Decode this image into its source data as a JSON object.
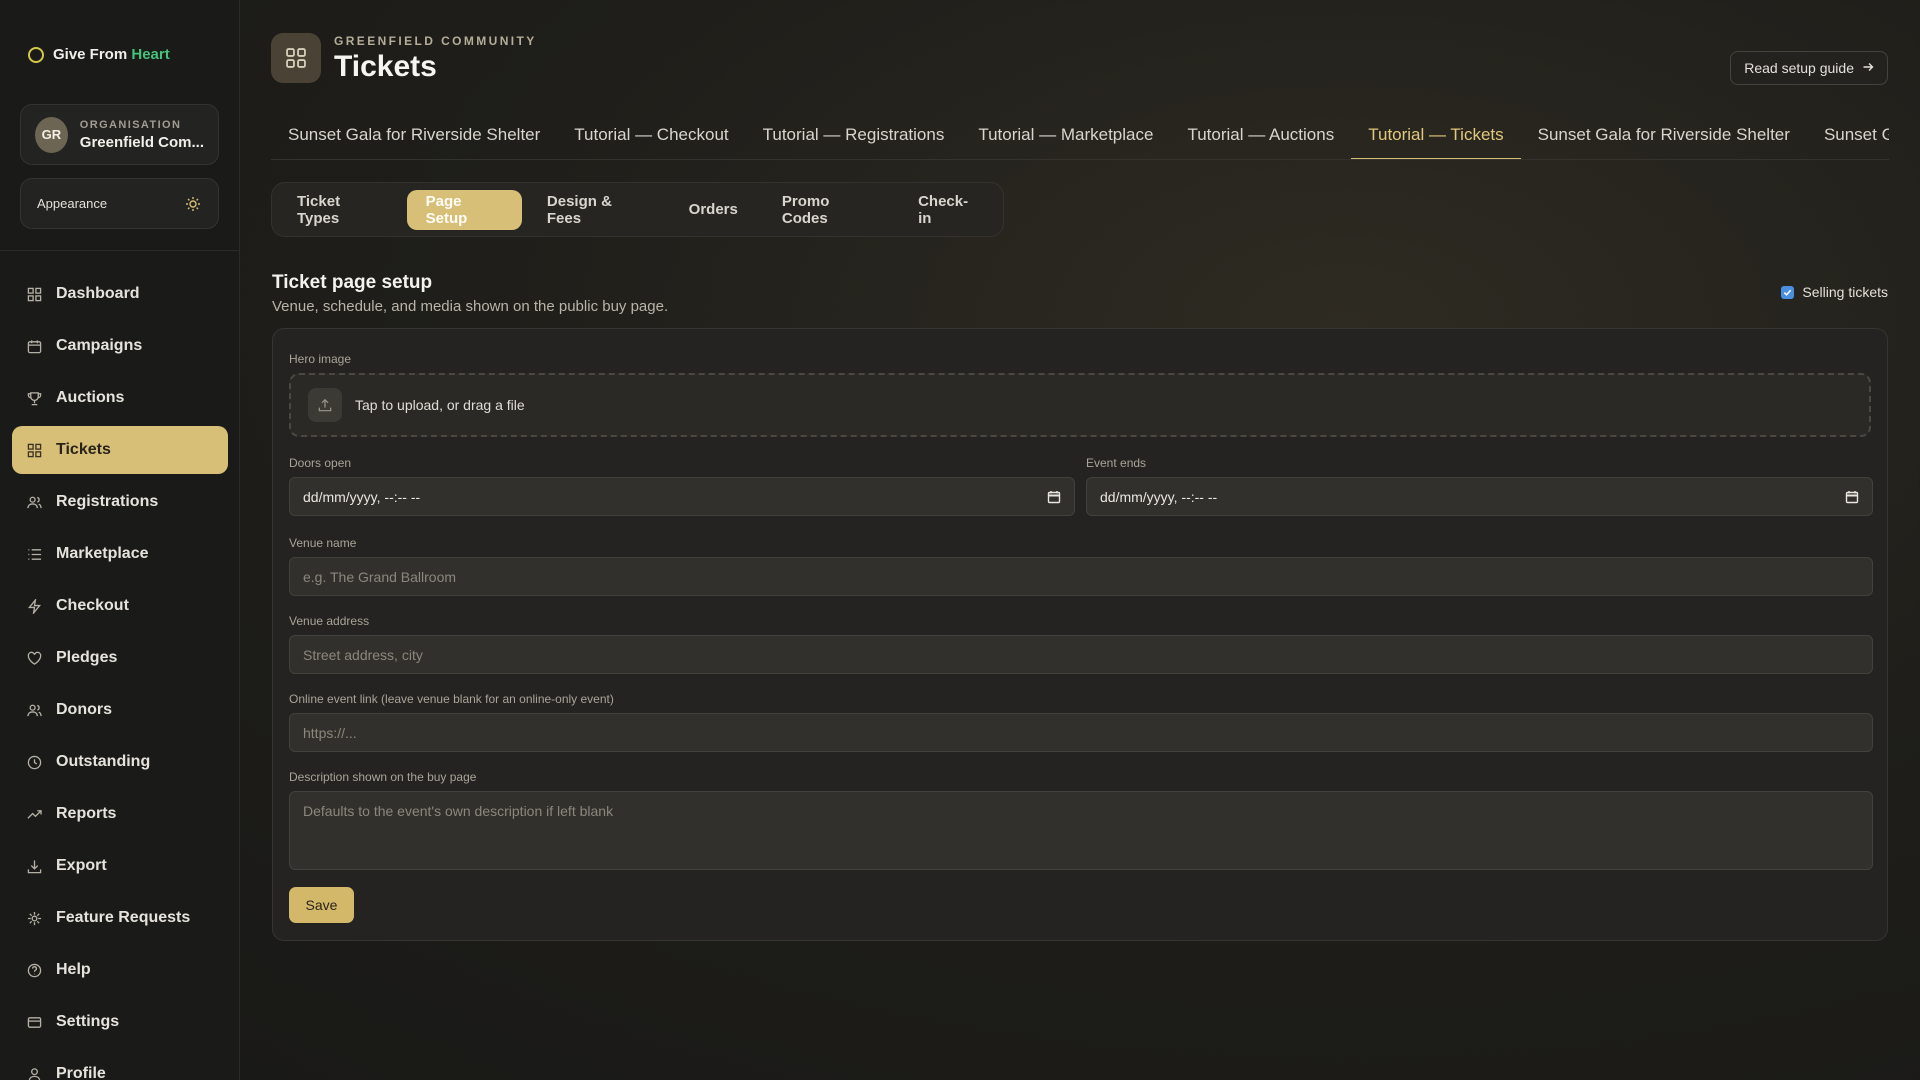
{
  "brand": {
    "name_prefix": "Give From ",
    "name_accent": "Heart"
  },
  "org": {
    "initials": "GR",
    "label": "ORGANISATION",
    "name": "Greenfield Com..."
  },
  "appearance": {
    "label": "Appearance",
    "icon": "sun-icon"
  },
  "sidebar": {
    "items": [
      {
        "label": "Dashboard",
        "icon": "dashboard-icon"
      },
      {
        "label": "Campaigns",
        "icon": "calendar-icon"
      },
      {
        "label": "Auctions",
        "icon": "trophy-icon"
      },
      {
        "label": "Tickets",
        "icon": "tickets-icon",
        "active": true
      },
      {
        "label": "Registrations",
        "icon": "users-icon"
      },
      {
        "label": "Marketplace",
        "icon": "list-icon"
      },
      {
        "label": "Checkout",
        "icon": "bolt-icon"
      },
      {
        "label": "Pledges",
        "icon": "heart-icon"
      },
      {
        "label": "Donors",
        "icon": "donors-icon"
      },
      {
        "label": "Outstanding",
        "icon": "clock-icon"
      },
      {
        "label": "Reports",
        "icon": "trend-icon"
      },
      {
        "label": "Export",
        "icon": "download-icon"
      },
      {
        "label": "Feature Requests",
        "icon": "spark-icon"
      },
      {
        "label": "Help",
        "icon": "help-icon"
      },
      {
        "label": "Settings",
        "icon": "card-icon"
      },
      {
        "label": "Profile",
        "icon": "profile-icon"
      }
    ]
  },
  "header": {
    "eyebrow": "GREENFIELD COMMUNITY",
    "title": "Tickets",
    "guide_button": "Read setup guide"
  },
  "event_tabs": [
    "Sunset Gala for Riverside Shelter",
    "Tutorial — Checkout",
    "Tutorial — Registrations",
    "Tutorial — Marketplace",
    "Tutorial — Auctions",
    "Tutorial — Tickets",
    "Sunset Gala for Riverside Shelter",
    "Sunset G"
  ],
  "active_event_tab": 5,
  "sub_tabs": [
    "Ticket Types",
    "Page Setup",
    "Design & Fees",
    "Orders",
    "Promo Codes",
    "Check-in"
  ],
  "active_sub_tab": 1,
  "section": {
    "title": "Ticket page setup",
    "subtitle": "Venue, schedule, and media shown on the public buy page.",
    "selling_label": "Selling tickets",
    "selling_checked": true
  },
  "form": {
    "hero_label": "Hero image",
    "upload_text": "Tap to upload, or drag a file",
    "doors_label": "Doors open",
    "doors_value": "dd/mm/yyyy, --:-- --",
    "ends_label": "Event ends",
    "ends_value": "dd/mm/yyyy, --:-- --",
    "venue_name_label": "Venue name",
    "venue_name_placeholder": "e.g. The Grand Ballroom",
    "venue_address_label": "Venue address",
    "venue_address_placeholder": "Street address, city",
    "online_label": "Online event link (leave venue blank for an online-only event)",
    "online_placeholder": "https://...",
    "description_label": "Description shown on the buy page",
    "description_placeholder": "Defaults to the event's own description if left blank",
    "save_label": "Save"
  },
  "colors": {
    "accent": "#d8bf78",
    "brand_green": "#47c17a",
    "background": "#1f1e1a"
  }
}
